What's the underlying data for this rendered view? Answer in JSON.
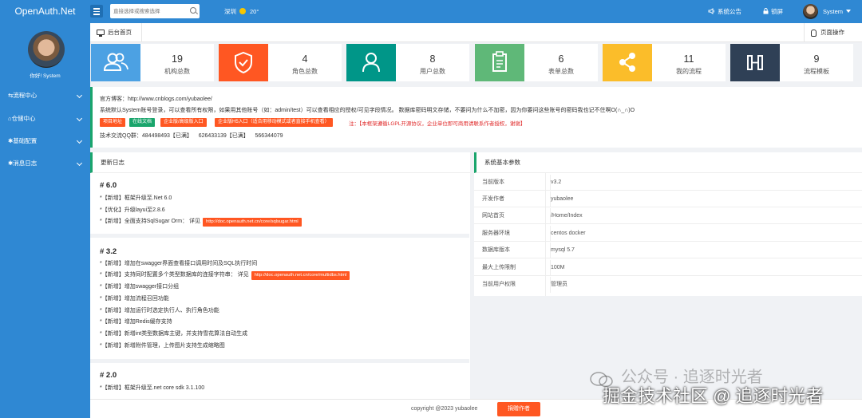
{
  "colors": {
    "brand": "#2f88d3",
    "accent_green": "#1aa56c",
    "orange": "#ff5722"
  },
  "header": {
    "brand": "OpenAuth.Net",
    "search_placeholder": "直接选择或搜索选择",
    "weather_city": "深圳",
    "weather_temp": "20°",
    "announcement": "系统公告",
    "lock": "锁屏",
    "user": "System"
  },
  "sidebar": {
    "hello": "你好! System",
    "items": [
      {
        "label": "流程中心",
        "icon": "flow-icon"
      },
      {
        "label": "仓储中心",
        "icon": "warehouse-icon"
      },
      {
        "label": "基础配置",
        "icon": "gear-icon"
      },
      {
        "label": "消息日志",
        "icon": "gear-icon"
      }
    ]
  },
  "tabs": {
    "home": "后台首页",
    "page_ops": "页面操作"
  },
  "stats": [
    {
      "value": "19",
      "label": "机构总数",
      "color": "#4ca1e3",
      "icon": "users-icon"
    },
    {
      "value": "4",
      "label": "角色总数",
      "color": "#ff5722",
      "icon": "shield-icon"
    },
    {
      "value": "8",
      "label": "用户总数",
      "color": "#009688",
      "icon": "user-icon"
    },
    {
      "value": "6",
      "label": "表单总数",
      "color": "#5fb878",
      "icon": "clipboard-icon"
    },
    {
      "value": "11",
      "label": "我的流程",
      "color": "#fbbd2a",
      "icon": "share-icon"
    },
    {
      "value": "9",
      "label": "流程模板",
      "color": "#2f4056",
      "icon": "flow-template-icon"
    }
  ],
  "info": {
    "blog": "官方博客：http://www.cnblogs.com/yubaolee/",
    "desc": "系统默认System账号登录，可以查看所有权限，如果用其他账号（如：admin/test）可以查看相应的授权/可见字段情况。 数据库密码明文存储，不要问为什么不加密，因为你要问这些账号的密码我也记不住啊O(∩_∩)O",
    "tags": [
      "项目地址",
      "在线文档",
      "企业版/高级版入口",
      "企业版H5入口（适合用移动模式或者直接手机查看）"
    ],
    "note": "注：【本框架遵循LGPL开源协议，企业单位即可商用请联系作者授权，谢谢】",
    "qq": "技术交流QQ群：484498493【已满】    626433139【已满】    566344079"
  },
  "changelog": {
    "title": "更新日志",
    "versions": [
      {
        "heading": "# 6.0",
        "items": [
          {
            "text": "*【新增】框架升级至.Net 6.0"
          },
          {
            "text": "*【优化】升级layui至2.8.6"
          },
          {
            "text": "*【新增】全面支持SqlSugar Orm： 详见",
            "link": "http://doc.openauth.net.cn/core/sqlsugar.html"
          }
        ]
      },
      {
        "heading": "# 3.2",
        "items": [
          {
            "text": "*【新增】增加在swagger界面查看接口调用时间及SQL执行时间"
          },
          {
            "text": "*【新增】支持同时配置多个类型数据库的连接字符串： 详见",
            "link": "http://doc.openauth.net.cn/core/multidbs.html"
          },
          {
            "text": "*【新增】增加swagger接口分组"
          },
          {
            "text": "*【新增】增加流程召回功能"
          },
          {
            "text": "*【新增】增加运行时选定执行人、执行角色功能"
          },
          {
            "text": "*【新增】增加Redis缓存支持"
          },
          {
            "text": "*【新增】新增int类型数据库主键，并支持雪花算法自动生成"
          },
          {
            "text": "*【新增】新增附件管理，上传图片支持生成缩略图"
          }
        ]
      },
      {
        "heading": "# 2.0",
        "items": [
          {
            "text": "*【新增】框架升级至.net core sdk 3.1.100"
          }
        ]
      }
    ]
  },
  "sysparams": {
    "title": "系统基本参数",
    "rows": [
      {
        "key": "当前版本",
        "value": "v3.2"
      },
      {
        "key": "开发作者",
        "value": "yubaolee"
      },
      {
        "key": "网站首页",
        "value": "/Home/Index"
      },
      {
        "key": "服务器环境",
        "value": "centos docker"
      },
      {
        "key": "数据库版本",
        "value": "mysql 5.7"
      },
      {
        "key": "最大上传限制",
        "value": "100M"
      },
      {
        "key": "当前用户权限",
        "value": "管理员"
      }
    ]
  },
  "footer": {
    "copyright": "copyright @2023 yubaolee",
    "donate": "捐赠作者"
  },
  "watermark": {
    "line1": "公众号 · 追逐时光者",
    "line2": "掘金技术社区 @ 追逐时光者"
  }
}
